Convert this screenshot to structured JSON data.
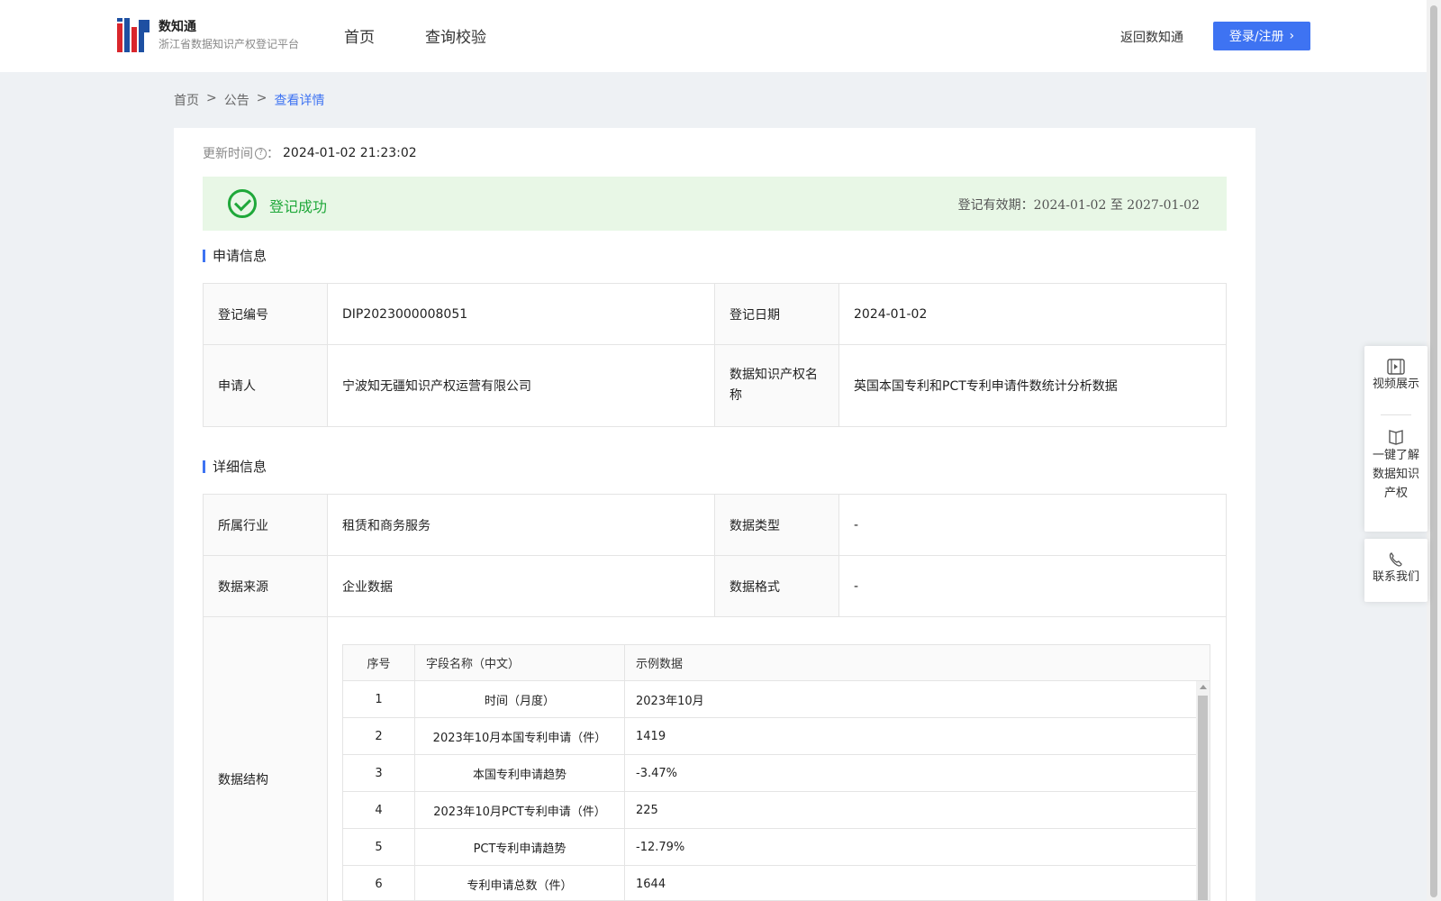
{
  "header": {
    "logo_title": "数知通",
    "logo_sub": "浙江省数据知识产权登记平台",
    "nav": [
      "首页",
      "查询校验"
    ],
    "back_link": "返回数知通",
    "login_label": "登录/注册"
  },
  "breadcrumb": [
    "首页",
    "公告",
    "查看详情"
  ],
  "update": {
    "label": "更新时间",
    "value": "2024-01-02 21:23:02"
  },
  "status": {
    "text": "登记成功",
    "validity_label": "登记有效期：",
    "validity_start": "2024-01-02",
    "validity_to": "至",
    "validity_end": "2027-01-02",
    "color": "#1fa83a"
  },
  "application": {
    "title": "申请信息",
    "reg_no_label": "登记编号",
    "reg_no": "DIP2023000008051",
    "reg_date_label": "登记日期",
    "reg_date": "2024-01-02",
    "applicant_label": "申请人",
    "applicant": "宁波知无疆知识产权运营有限公司",
    "name_label": "数据知识产权名称",
    "name": "英国本国专利和PCT专利申请件数统计分析数据"
  },
  "details": {
    "title": "详细信息",
    "industry_label": "所属行业",
    "industry": "租赁和商务服务",
    "type_label": "数据类型",
    "type": "-",
    "source_label": "数据来源",
    "source": "企业数据",
    "format_label": "数据格式",
    "format": "-",
    "structure_label": "数据结构"
  },
  "structure_table": {
    "headers": [
      "序号",
      "字段名称（中文）",
      "示例数据"
    ],
    "rows": [
      [
        "1",
        "时间（月度）",
        "2023年10月"
      ],
      [
        "2",
        "2023年10月本国专利申请（件）",
        "1419"
      ],
      [
        "3",
        "本国专利申请趋势",
        "-3.47%"
      ],
      [
        "4",
        "2023年10月PCT专利申请（件）",
        "225"
      ],
      [
        "5",
        "PCT专利申请趋势",
        "-12.79%"
      ],
      [
        "6",
        "专利申请总数（件）",
        "1644"
      ]
    ]
  },
  "side_widget": {
    "video": "视频展示",
    "learn_lines": [
      "一键了解",
      "数据知识",
      "产权"
    ],
    "contact": "联系我们"
  },
  "colors": {
    "accent": "#3e73f2",
    "success_bg": "#e8f7e6"
  }
}
